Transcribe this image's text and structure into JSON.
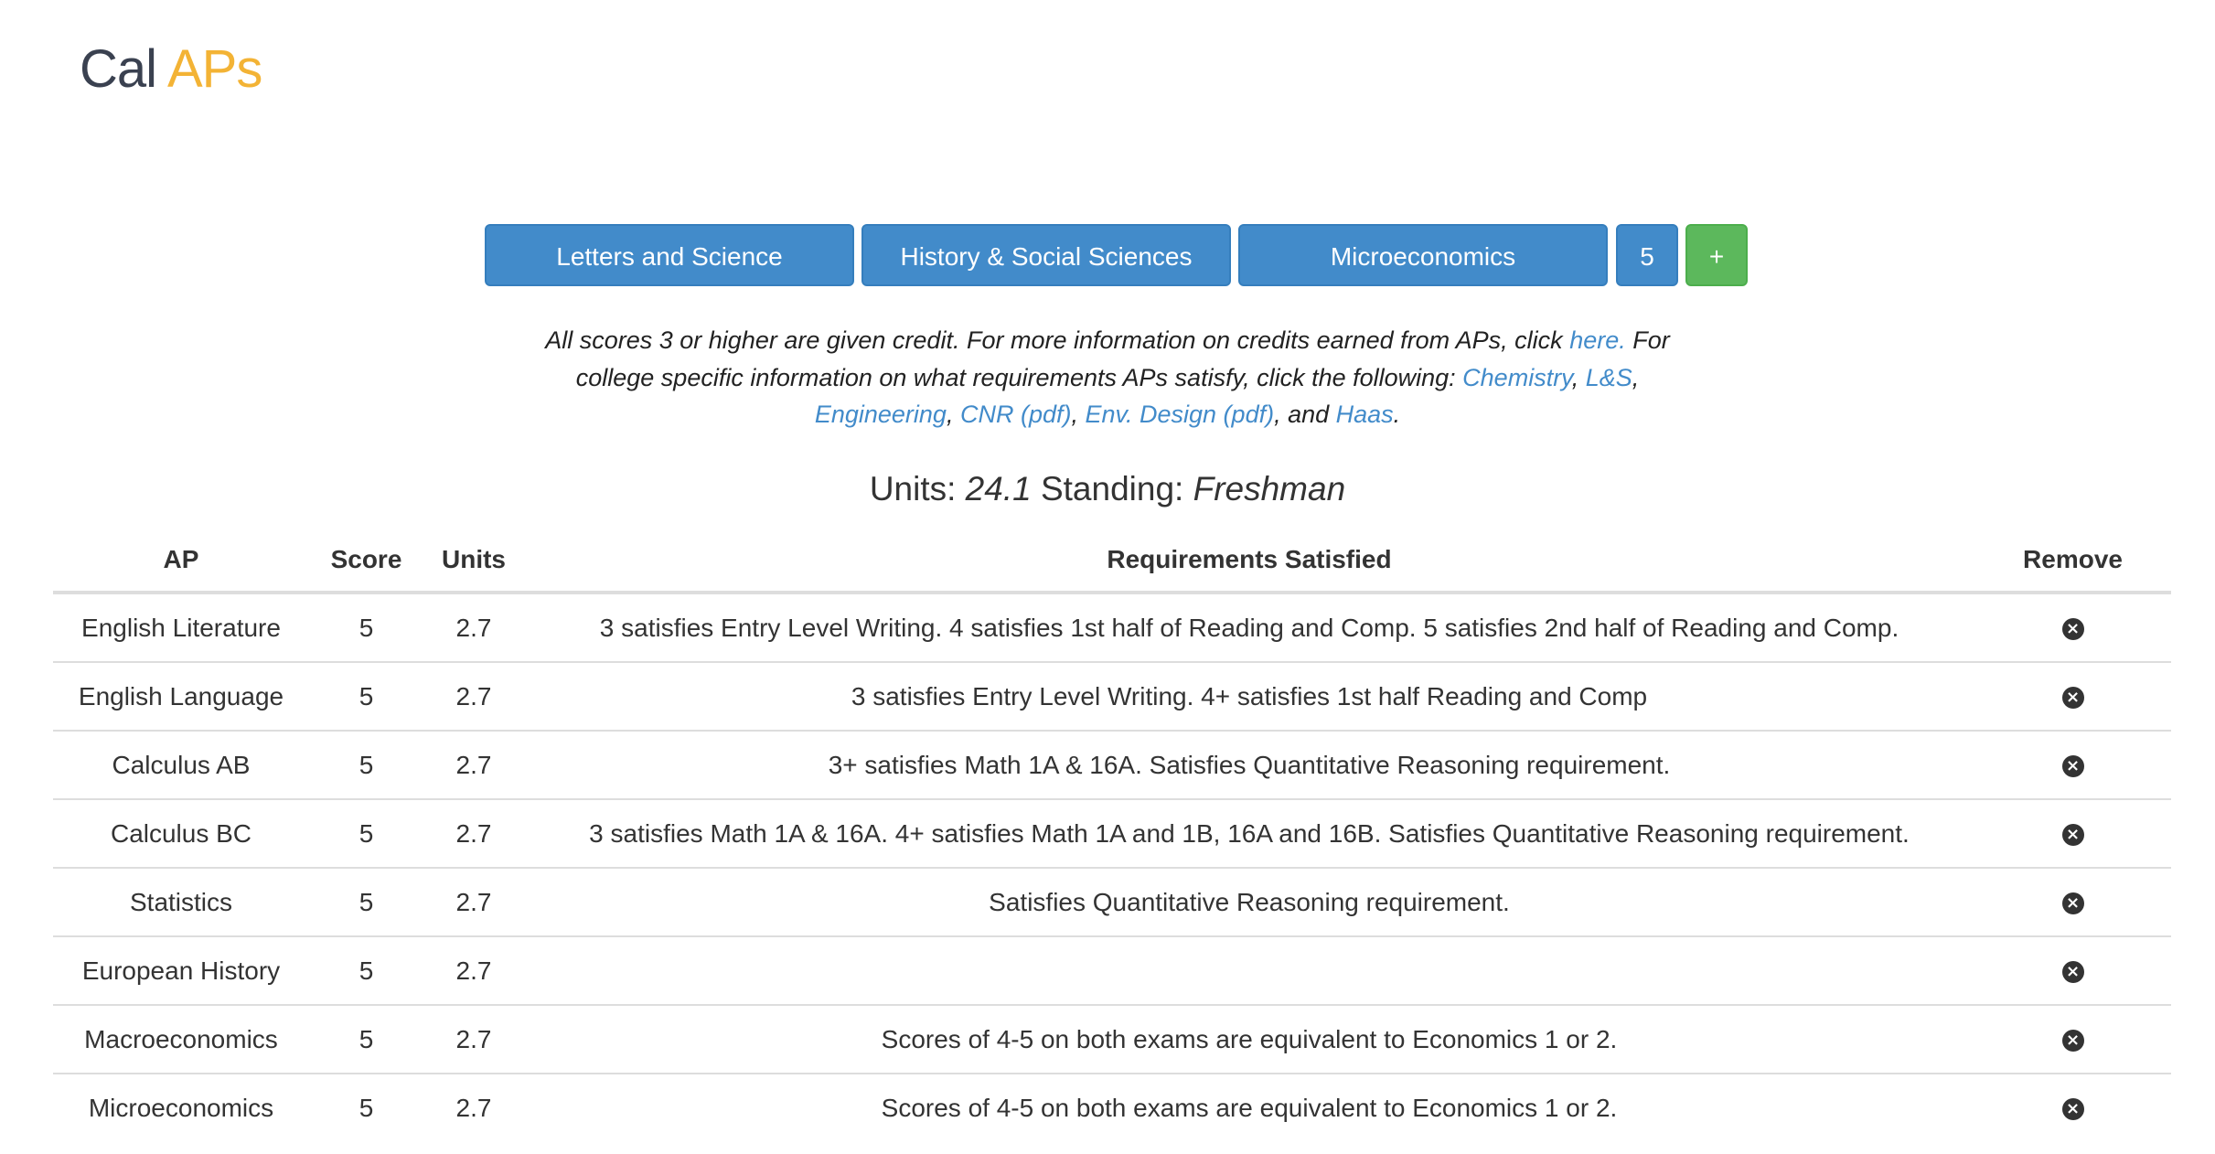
{
  "brand": {
    "cal": "Cal",
    "aps": "APs"
  },
  "selectors": {
    "college": "Letters and Science",
    "category": "History & Social Sciences",
    "exam": "Microeconomics",
    "score": "5",
    "add": "+"
  },
  "info": {
    "p1": "All scores 3 or higher are given credit. For more information on credits earned from APs, click ",
    "here": "here.",
    "p2": " For college specific information on what requirements APs satisfy, click the following: ",
    "links": [
      "Chemistry",
      "L&S",
      "Engineering",
      "CNR (pdf)",
      "Env. Design (pdf)",
      "Haas"
    ],
    "sep": ", ",
    "and": ", and ",
    "end": "."
  },
  "summary": {
    "units_label": "Units:",
    "units": "24.1",
    "standing_label": "Standing:",
    "standing": "Freshman"
  },
  "table": {
    "headers": [
      "AP",
      "Score",
      "Units",
      "Requirements Satisfied",
      "Remove"
    ],
    "remove_icon": "close-circle-icon",
    "rows": [
      {
        "ap": "English Literature",
        "score": "5",
        "units": "2.7",
        "req": "3 satisfies Entry Level Writing. 4 satisfies 1st half of Reading and Comp. 5 satisfies 2nd half of Reading and Comp."
      },
      {
        "ap": "English Language",
        "score": "5",
        "units": "2.7",
        "req": "3 satisfies Entry Level Writing. 4+ satisfies 1st half Reading and Comp"
      },
      {
        "ap": "Calculus AB",
        "score": "5",
        "units": "2.7",
        "req": "3+ satisfies Math 1A & 16A. Satisfies Quantitative Reasoning requirement."
      },
      {
        "ap": "Calculus BC",
        "score": "5",
        "units": "2.7",
        "req": "3 satisfies Math 1A & 16A. 4+ satisfies Math 1A and 1B, 16A and 16B. Satisfies Quantitative Reasoning requirement."
      },
      {
        "ap": "Statistics",
        "score": "5",
        "units": "2.7",
        "req": "Satisfies Quantitative Reasoning requirement."
      },
      {
        "ap": "European History",
        "score": "5",
        "units": "2.7",
        "req": ""
      },
      {
        "ap": "Macroeconomics",
        "score": "5",
        "units": "2.7",
        "req": "Scores of 4-5 on both exams are equivalent to Economics 1 or 2."
      },
      {
        "ap": "Microeconomics",
        "score": "5",
        "units": "2.7",
        "req": "Scores of 4-5 on both exams are equivalent to Economics 1 or 2."
      }
    ]
  }
}
